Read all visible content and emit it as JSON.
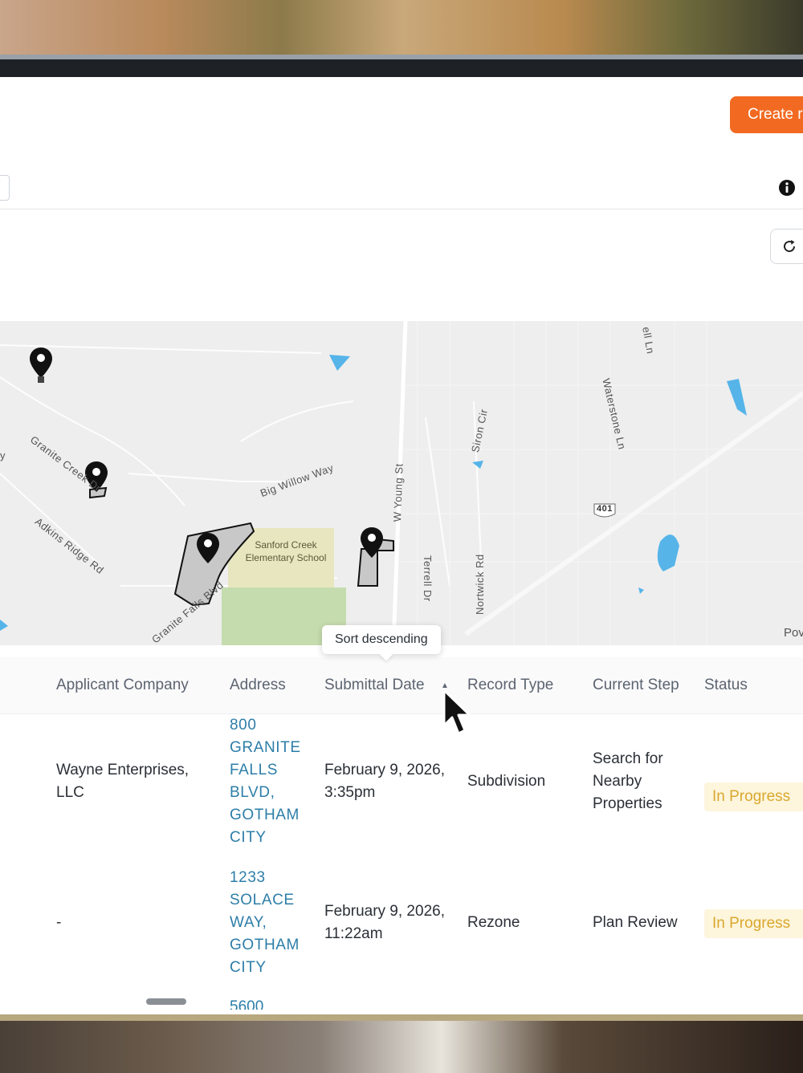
{
  "toolbar": {
    "create_label": "Create r"
  },
  "map": {
    "streets": {
      "granite_creek": "Granite Creek Dr",
      "big_willow": "Big Willow Way",
      "w_young": "W Young St",
      "siron": "Siron Cir",
      "waterstone": "Waterstone Ln",
      "ell": "ell Ln",
      "adkins": "Adkins Ridge Rd",
      "terrell": "Terrell Dr",
      "nortwick": "Nortwick Rd",
      "granite_falls": "Granite Falls Blvd",
      "left_edge": "y"
    },
    "highway": "401",
    "school": "Sanford Creek Elementary School",
    "edge_label": "Pov"
  },
  "tooltip": "Sort descending",
  "table": {
    "columns": [
      "Applicant Company",
      "Address",
      "Submittal Date",
      "Record Type",
      "Current Step",
      "Status"
    ],
    "rows": [
      {
        "company": "Wayne Enterprises, LLC",
        "address": "800 GRANITE FALLS BLVD, GOTHAM CITY",
        "date": "February 9, 2026, 3:35pm",
        "record_type": "Subdivision",
        "step": "Search for Nearby Properties",
        "status": "In Progress"
      },
      {
        "company": "-",
        "address": "1233 SOLACE WAY, GOTHAM CITY",
        "date": "February 9, 2026, 11:22am",
        "record_type": "Rezone",
        "step": "Plan Review",
        "status": "In Progress"
      }
    ],
    "partial_next_address": "5600"
  },
  "colors": {
    "accent": "#f26a21",
    "link": "#2d7ea8",
    "status_bg": "#fdf5dc",
    "status_text": "#d9a82e"
  },
  "icons": [
    "info-icon",
    "refresh-icon",
    "map-pin-icon",
    "mouse-cursor-icon",
    "sort-arrow-icon"
  ]
}
